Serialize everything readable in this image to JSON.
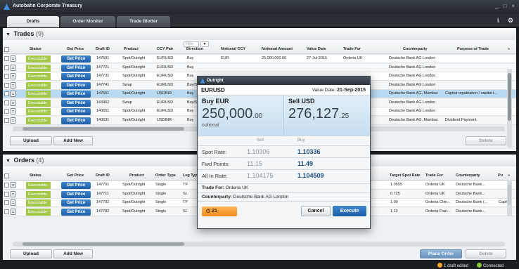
{
  "window": {
    "title": "Autobahn Corporate Treasury",
    "controls": [
      "_",
      "□",
      "×"
    ]
  },
  "tabs": [
    {
      "label": "Drafts"
    },
    {
      "label": "Order Monitor"
    },
    {
      "label": "Trade Blotter"
    }
  ],
  "toolbar": {
    "info": "i",
    "settings": "⚙"
  },
  "trades": {
    "title": "Trades",
    "count": "(9)",
    "filter_placeholder": "Filter",
    "columns": [
      "Status",
      "Get Price",
      "Draft ID",
      "Product",
      "CCY Pair",
      "Direction",
      "Notional CCY",
      "Notional Amount",
      "Value Date",
      "Trade For",
      "Counterparty",
      "Purpose of Trade"
    ],
    "more": "»",
    "rows": [
      {
        "status": "Executable",
        "get_price": "Get Price",
        "draft_id": "147691",
        "product": "Spot/Outright",
        "ccy_pair": "EURUSD",
        "direction": "Buy",
        "notional_ccy": "EUR",
        "amount": "25,000,000.00",
        "value_date": "27-Jul-2015",
        "trade_for": "Orderia UK",
        "counterparty": "Deutsche Bank AG London",
        "purpose": ""
      },
      {
        "status": "Executable",
        "get_price": "Get Price",
        "draft_id": "147721",
        "product": "Spot/Outright",
        "ccy_pair": "EURUSD",
        "direction": "Buy",
        "notional_ccy": "",
        "amount": "",
        "value_date": "",
        "trade_for": "",
        "counterparty": "Deutsche Bank AG London",
        "purpose": ""
      },
      {
        "status": "Executable",
        "get_price": "Get Price",
        "draft_id": "147731",
        "product": "Spot/Outright",
        "ccy_pair": "EURUSD",
        "direction": "Buy",
        "notional_ccy": "",
        "amount": "",
        "value_date": "",
        "trade_for": "",
        "counterparty": "Deutsche Bank AG London",
        "purpose": ""
      },
      {
        "status": "Executable",
        "get_price": "Get Price",
        "draft_id": "147741",
        "product": "Swap",
        "ccy_pair": "EURUSD",
        "direction": "Buy/S",
        "notional_ccy": "",
        "amount": "",
        "value_date": "",
        "trade_for": "",
        "counterparty": "Deutsche Bank AG London",
        "purpose": ""
      },
      {
        "status": "Executable",
        "get_price": "Get Price",
        "draft_id": "147661",
        "product": "Spot/Outright",
        "ccy_pair": "USDINR",
        "direction": "Buy",
        "notional_ccy": "",
        "amount": "",
        "value_date": "",
        "trade_for": "a DDF",
        "counterparty": "Deutsche Bank AG, Mumbai",
        "purpose": "Capital repatriation / capital i..."
      },
      {
        "status": "Executable",
        "get_price": "Get Price",
        "draft_id": "143462",
        "product": "Swap",
        "ccy_pair": "EURUSD",
        "direction": "Buy/S",
        "notional_ccy": "",
        "amount": "",
        "value_date": "",
        "trade_for": "",
        "counterparty": "Deutsche Bank AG London",
        "purpose": ""
      },
      {
        "status": "Executable",
        "get_price": "Get Price",
        "draft_id": "140651",
        "product": "Spot/Outright",
        "ccy_pair": "EURUSD",
        "direction": "Buy",
        "notional_ccy": "",
        "amount": "",
        "value_date": "",
        "trade_for": "",
        "counterparty": "Deutsche Bank AG London",
        "purpose": ""
      },
      {
        "status": "Executable",
        "get_price": "Get Price",
        "draft_id": "140631",
        "product": "Spot/Outright",
        "ccy_pair": "USDINR",
        "direction": "Buy",
        "notional_ccy": "",
        "amount": "",
        "value_date": "",
        "trade_for": "a DDF",
        "counterparty": "Deutsche Bank AG, Mumbai",
        "purpose": "Dividend Payment"
      }
    ],
    "upload": "Upload",
    "add_new": "Add New",
    "delete": "Delete"
  },
  "orders": {
    "title": "Orders",
    "count": "(4)",
    "columns": [
      "Status",
      "Get Price",
      "Draft ID",
      "Product",
      "Order Type",
      "Leg Typ",
      "Target Spot Rate",
      "Trade For",
      "Counterparty",
      "Pu"
    ],
    "more": "»",
    "rows": [
      {
        "status": "Executable",
        "get_price": "Get Price",
        "draft_id": "147701",
        "product": "Spot/Outright",
        "order_type": "Single",
        "leg": "TP",
        "pair": "",
        "dir": "",
        "ccy": "",
        "amount": "",
        "target": "1.0555",
        "trade_for": "Orderia UK",
        "counterparty": "Deutsche Bank...",
        "purpose": ""
      },
      {
        "status": "Executable",
        "get_price": "Get Price",
        "draft_id": "147711",
        "product": "Spot/Outright",
        "order_type": "Single",
        "leg": "SL",
        "pair": "",
        "dir": "",
        "ccy": "",
        "amount": "",
        "target": "0.725",
        "trade_for": "Orderia UK",
        "counterparty": "Deutsche Bank...",
        "purpose": ""
      },
      {
        "status": "Executable",
        "get_price": "Get Price",
        "draft_id": "147792",
        "product": "Spot/Outright",
        "order_type": "Single",
        "leg": "TP",
        "pair": "USDCNY",
        "dir": "Buy",
        "ccy": "USD",
        "amount": "1,000,000.00",
        "target": "1.09",
        "trade_for": "Orderia Chin...",
        "counterparty": "Deutsche Bank (...",
        "purpose": "Capital"
      },
      {
        "status": "Executable",
        "get_price": "Get Price",
        "draft_id": "147782",
        "product": "Spot/Outright",
        "order_type": "Single",
        "leg": "SL",
        "pair": "EURUSD",
        "dir": "Buy",
        "ccy": "USD",
        "amount": "1,000,000.00",
        "target": "1.12",
        "trade_for": "Orderia Fran...",
        "counterparty": "Deutsche Bank...",
        "purpose": ""
      }
    ],
    "upload": "Upload",
    "add_new": "Add New",
    "place_order": "Place Order",
    "delete": "Delete"
  },
  "statusbar": {
    "draft_edited": "1 draft edited",
    "connected": "Connected"
  },
  "modal": {
    "title": "Outright",
    "pair": "EURUSD",
    "value_date_label": "Value Date:",
    "value_date": "21-Sep-2015",
    "buy_label": "Buy EUR",
    "buy_big": "250,000",
    "buy_small": ".00",
    "notional_label": "notional",
    "sell_label": "Sell USD",
    "sell_big": "276,127",
    "sell_small": ".25",
    "col_sell": "Sell",
    "col_buy": "Buy",
    "spot_label": "Spot Rate:",
    "spot_sell": "1.10306",
    "spot_buy": "1.10336",
    "fwd_label": "Fwd Points:",
    "fwd_sell": "11.15",
    "fwd_buy": "11.49",
    "allin_label": "All In Rate:",
    "allin_sell": "1.104175",
    "allin_buy": "1.104509",
    "trade_for_label": "Trade For:",
    "trade_for": "Orderia UK",
    "cpty_label": "Counterparty:",
    "cpty": "Deutsche Bank AG London",
    "timer": "21",
    "cancel": "Cancel",
    "execute": "Execute"
  },
  "colors": {
    "accent": "#1d5ea8",
    "executable": "#a4c84a",
    "highlight": "#b9d9f0",
    "timer": "#f08a1a"
  }
}
